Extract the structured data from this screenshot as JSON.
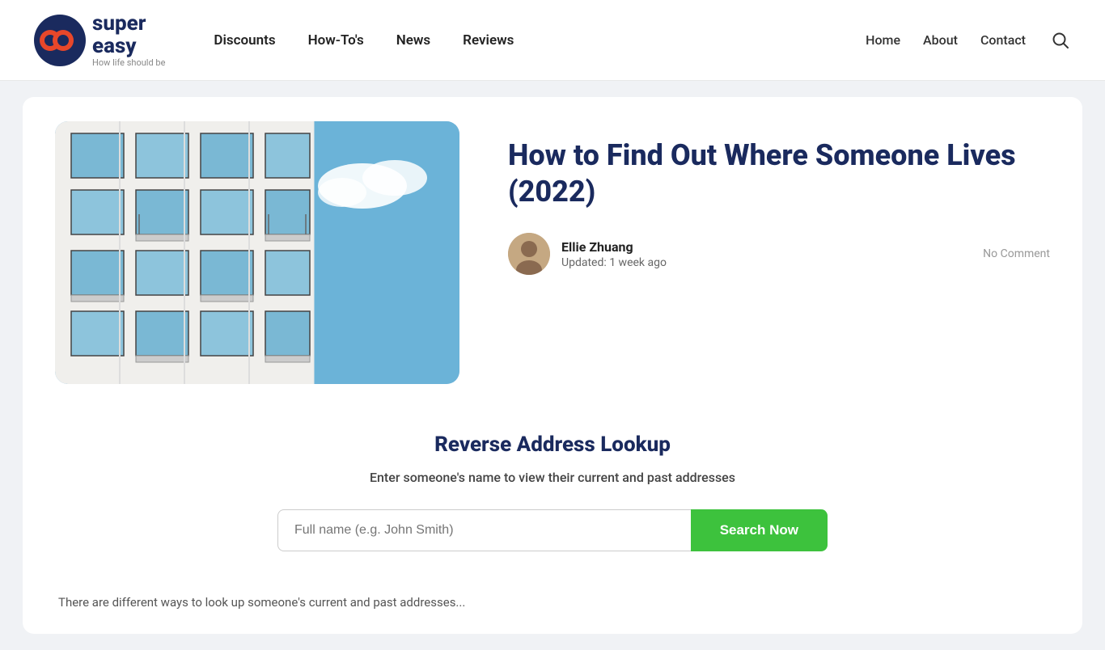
{
  "header": {
    "logo": {
      "brand_super": "super",
      "brand_easy": "easy",
      "tagline": "How life should be"
    },
    "main_nav": [
      {
        "label": "Discounts",
        "href": "#"
      },
      {
        "label": "How-To's",
        "href": "#"
      },
      {
        "label": "News",
        "href": "#"
      },
      {
        "label": "Reviews",
        "href": "#"
      }
    ],
    "right_nav": [
      {
        "label": "Home",
        "href": "#"
      },
      {
        "label": "About",
        "href": "#"
      },
      {
        "label": "Contact",
        "href": "#"
      }
    ]
  },
  "article": {
    "title": "How to Find Out Where Someone Lives (2022)",
    "author_name": "Ellie Zhuang",
    "author_updated": "Updated: 1 week ago",
    "no_comment_label": "No Comment"
  },
  "lookup_widget": {
    "title": "Reverse Address Lookup",
    "subtitle": "Enter someone's name to view their current and past addresses",
    "input_placeholder": "Full name (e.g. John Smith)",
    "button_label": "Search Now"
  },
  "bottom_hint": "There are different ways to look up someone's current and past addresses..."
}
